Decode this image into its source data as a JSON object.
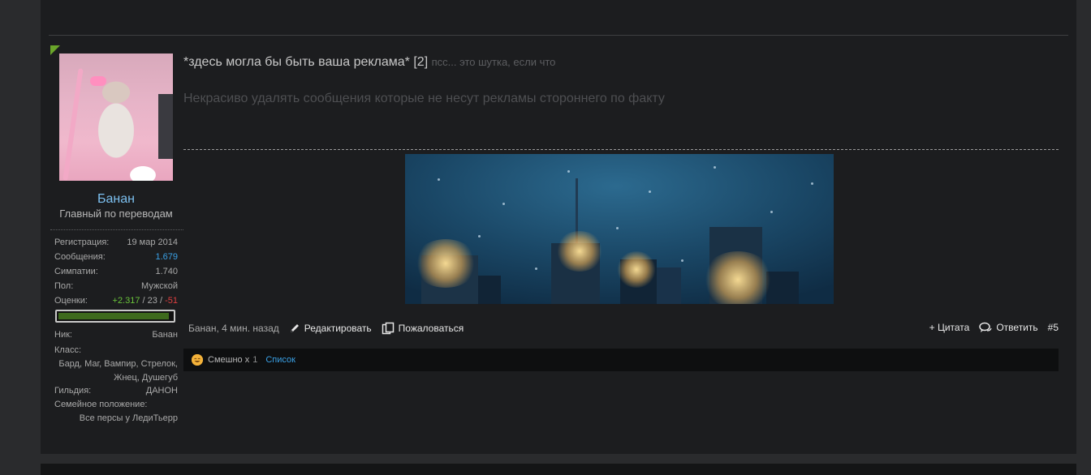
{
  "user": {
    "name": "Банан",
    "title": "Главный по переводам",
    "stats": [
      {
        "label": "Регистрация:",
        "value": "19 мар 2014"
      },
      {
        "label": "Сообщения:",
        "value": "1.679"
      },
      {
        "label": "Симпатии:",
        "value": "1.740"
      },
      {
        "label": "Пол:",
        "value": "Мужской"
      }
    ],
    "ratings": {
      "label": "Оценки:",
      "positive": "+2.317",
      "neutral": "23",
      "negative": "-51",
      "sep": "/"
    },
    "rating_bar_fraction": 0.97,
    "nick": {
      "label": "Ник:",
      "value": "Банан"
    },
    "class_label": "Класс:",
    "class_value_line1": "Бард, Маг, Вампир, Стрелок,",
    "class_value_line2": "Жнец, Душегуб",
    "guild": {
      "label": "Гильдия:",
      "value": "ДАНОН"
    },
    "family_label": "Семейное положение:",
    "family_value": "Все персы у ЛедиТьерр"
  },
  "post": {
    "title": "*здесь могла бы быть ваша реклама*",
    "title_num": "[2]",
    "title_aside": "псс... это шутка, если что",
    "body": "Некрасиво удалять сообщения которые не несут рекламы стороннего по факту",
    "author_time": "Банан, 4 мин. назад",
    "edit_label": "Редактировать",
    "report_label": "Пожаловаться",
    "quote_label": "+ Цитата",
    "reply_label": "Ответить",
    "post_number": "#5"
  },
  "likes": {
    "label": "Смешно x",
    "count": "1",
    "list_label": "Список"
  },
  "colors": {
    "accent_blue": "#3aa1e6",
    "username_blue": "#7cc0f0",
    "positive": "#6ac43a",
    "negative": "#e04040",
    "flag_green": "#6aa52a"
  }
}
